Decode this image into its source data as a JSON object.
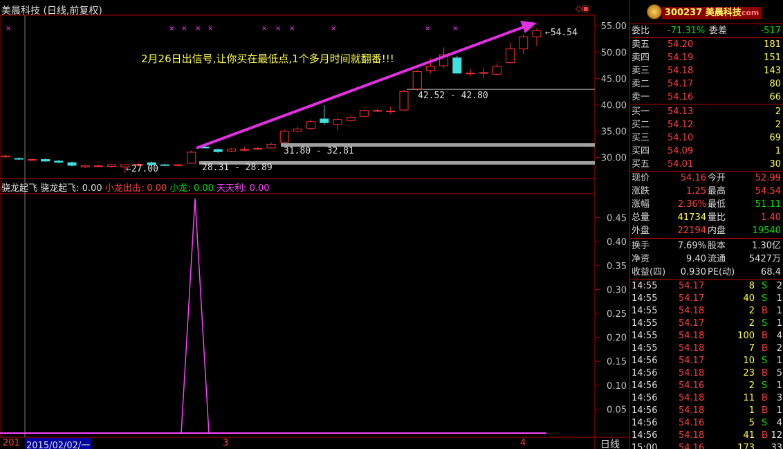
{
  "header": {
    "title": "美晨科技 (日线,前复权)",
    "code": "300237",
    "name": "美晨科技",
    "brand_suffix": "com"
  },
  "price_chart": {
    "annotation": "2月26日出信号,让你买在最低点,1个多月时间就翻番!!!",
    "last_price_label": "54.54",
    "low_label": "27.00",
    "range_labels": [
      "28.31 - 28.89",
      "31.80 - 32.81",
      "42.52 - 42.80"
    ],
    "y_ticks": [
      "55.00",
      "50.00",
      "45.00",
      "40.00",
      "35.00",
      "30.00"
    ]
  },
  "indicator": {
    "title": "骁龙起飞",
    "items": [
      {
        "label": "骁龙起飞:",
        "value": "0.00",
        "color": "#e0e0e0"
      },
      {
        "label": "小龙出击:",
        "value": "0.00",
        "color": "#ff4040"
      },
      {
        "label": "小龙:",
        "value": "0.00",
        "color": "#00e000"
      },
      {
        "label": "天天利:",
        "value": "0.00",
        "color": "#ff40ff"
      }
    ],
    "y_ticks": [
      "0.45",
      "0.40",
      "0.35",
      "0.30",
      "0.25",
      "0.20",
      "0.15",
      "0.10",
      "0.05"
    ]
  },
  "x_axis": {
    "year_prefix": "201",
    "cursor_date": "2015/02/02/一",
    "month_labels": [
      "3",
      "4"
    ],
    "period": "日线"
  },
  "order_book": {
    "ratio_label": "委比",
    "ratio_value": "-71.31%",
    "diff_label": "委差",
    "diff_value": "-517",
    "asks": [
      {
        "label": "卖五",
        "price": "54.20",
        "volume": "181"
      },
      {
        "label": "卖四",
        "price": "54.19",
        "volume": "151"
      },
      {
        "label": "卖三",
        "price": "54.18",
        "volume": "143"
      },
      {
        "label": "卖二",
        "price": "54.17",
        "volume": "80"
      },
      {
        "label": "卖一",
        "price": "54.16",
        "volume": "66"
      }
    ],
    "bids": [
      {
        "label": "买一",
        "price": "54.13",
        "volume": "2"
      },
      {
        "label": "买二",
        "price": "54.12",
        "volume": "2"
      },
      {
        "label": "买三",
        "price": "54.10",
        "volume": "69"
      },
      {
        "label": "买四",
        "price": "54.09",
        "volume": "1"
      },
      {
        "label": "买五",
        "price": "54.01",
        "volume": "30"
      }
    ]
  },
  "quote": {
    "rows": [
      {
        "l1": "现价",
        "v1": "54.16",
        "c1": "red",
        "l2": "今开",
        "v2": "52.99",
        "c2": "red"
      },
      {
        "l1": "涨跌",
        "v1": "1.25",
        "c1": "red",
        "l2": "最高",
        "v2": "54.54",
        "c2": "red"
      },
      {
        "l1": "涨幅",
        "v1": "2.36%",
        "c1": "red",
        "l2": "最低",
        "v2": "51.11",
        "c2": "green"
      },
      {
        "l1": "总量",
        "v1": "41734",
        "c1": "yellow",
        "l2": "量比",
        "v2": "1.40",
        "c2": "red"
      },
      {
        "l1": "外盘",
        "v1": "22194",
        "c1": "red",
        "l2": "内盘",
        "v2": "19540",
        "c2": "green"
      }
    ],
    "rows2": [
      {
        "l1": "换手",
        "v1": "7.69%",
        "l2": "股本",
        "v2": "1.30亿"
      },
      {
        "l1": "净资",
        "v1": "9.40",
        "l2": "流通",
        "v2": "5427万"
      },
      {
        "l1": "收益(四)",
        "v1": "0.930",
        "l2": "PE(动)",
        "v2": "68.4"
      }
    ]
  },
  "ticks": [
    {
      "time": "14:55",
      "price": "54.17",
      "vol": "8",
      "side": "S",
      "n": "2"
    },
    {
      "time": "14:55",
      "price": "54.17",
      "vol": "40",
      "side": "S",
      "n": "1"
    },
    {
      "time": "14:55",
      "price": "54.18",
      "vol": "2",
      "side": "B",
      "n": "1"
    },
    {
      "time": "14:55",
      "price": "54.17",
      "vol": "2",
      "side": "S",
      "n": "1"
    },
    {
      "time": "14:55",
      "price": "54.18",
      "vol": "100",
      "side": "B",
      "n": "4"
    },
    {
      "time": "14:55",
      "price": "54.18",
      "vol": "7",
      "side": "B",
      "n": "2"
    },
    {
      "time": "14:56",
      "price": "54.17",
      "vol": "10",
      "side": "S",
      "n": "1"
    },
    {
      "time": "14:56",
      "price": "54.18",
      "vol": "23",
      "side": "B",
      "n": "5"
    },
    {
      "time": "14:56",
      "price": "54.16",
      "vol": "2",
      "side": "S",
      "n": "1"
    },
    {
      "time": "14:56",
      "price": "54.18",
      "vol": "11",
      "side": "B",
      "n": "3"
    },
    {
      "time": "14:56",
      "price": "54.18",
      "vol": "1",
      "side": "B",
      "n": "1"
    },
    {
      "time": "14:56",
      "price": "54.16",
      "vol": "5",
      "side": "S",
      "n": "4"
    },
    {
      "time": "14:56",
      "price": "54.18",
      "vol": "41",
      "side": "B",
      "n": "12"
    },
    {
      "time": "15:00",
      "price": "54.16",
      "vol": "173",
      "side": "",
      "n": "33"
    }
  ],
  "colors": {
    "up": "#ff3030",
    "down": "#40e0e0",
    "grid": "#b00000",
    "arrow": "#e030e0",
    "annotation": "#ffff40",
    "support_band": "#a0a0a0"
  },
  "chart_data": {
    "type": "candlestick",
    "y_unit": "price",
    "ylim": [
      26,
      57
    ],
    "candles": [
      {
        "o": 30.1,
        "c": 30.3,
        "h": 30.5,
        "l": 29.9
      },
      {
        "o": 29.8,
        "c": 29.7,
        "h": 30.0,
        "l": 29.5
      },
      {
        "o": 29.6,
        "c": 29.6,
        "h": 29.8,
        "l": 29.4
      },
      {
        "o": 29.6,
        "c": 29.3,
        "h": 29.8,
        "l": 29.2
      },
      {
        "o": 29.3,
        "c": 29.1,
        "h": 29.5,
        "l": 28.9
      },
      {
        "o": 29.0,
        "c": 28.5,
        "h": 29.2,
        "l": 28.3
      },
      {
        "o": 28.2,
        "c": 28.4,
        "h": 28.6,
        "l": 28.0
      },
      {
        "o": 28.4,
        "c": 28.4,
        "h": 28.6,
        "l": 28.2
      },
      {
        "o": 28.3,
        "c": 28.6,
        "h": 28.7,
        "l": 28.1
      },
      {
        "o": 28.2,
        "c": 28.6,
        "h": 28.7,
        "l": 27.0
      },
      {
        "o": 28.5,
        "c": 28.7,
        "h": 28.9,
        "l": 28.3
      },
      {
        "o": 29.0,
        "c": 28.6,
        "h": 29.2,
        "l": 28.4
      },
      {
        "o": 28.6,
        "c": 28.5,
        "h": 28.8,
        "l": 28.4
      },
      {
        "o": 28.6,
        "c": 28.6,
        "h": 28.7,
        "l": 28.4
      },
      {
        "o": 28.9,
        "c": 31.0,
        "h": 31.3,
        "l": 28.8
      },
      {
        "o": 32.0,
        "c": 31.8,
        "h": 32.2,
        "l": 31.7
      },
      {
        "o": 31.5,
        "c": 31.1,
        "h": 31.7,
        "l": 30.9
      },
      {
        "o": 31.2,
        "c": 31.6,
        "h": 31.8,
        "l": 31.0
      },
      {
        "o": 31.5,
        "c": 31.5,
        "h": 31.9,
        "l": 31.2
      },
      {
        "o": 31.6,
        "c": 31.7,
        "h": 32.0,
        "l": 31.4
      },
      {
        "o": 31.8,
        "c": 32.5,
        "h": 32.8,
        "l": 31.7
      },
      {
        "o": 32.9,
        "c": 35.0,
        "h": 35.3,
        "l": 32.8
      },
      {
        "o": 35.0,
        "c": 35.4,
        "h": 35.8,
        "l": 34.8
      },
      {
        "o": 35.5,
        "c": 36.8,
        "h": 37.2,
        "l": 35.2
      },
      {
        "o": 37.3,
        "c": 36.6,
        "h": 39.9,
        "l": 36.2
      },
      {
        "o": 36.3,
        "c": 37.2,
        "h": 37.6,
        "l": 35.2
      },
      {
        "o": 37.0,
        "c": 37.6,
        "h": 38.0,
        "l": 36.8
      },
      {
        "o": 37.8,
        "c": 38.9,
        "h": 39.1,
        "l": 37.6
      },
      {
        "o": 38.9,
        "c": 38.9,
        "h": 39.3,
        "l": 38.6
      },
      {
        "o": 38.8,
        "c": 38.8,
        "h": 39.6,
        "l": 38.3
      },
      {
        "o": 39.0,
        "c": 42.5,
        "h": 42.8,
        "l": 38.8
      },
      {
        "o": 43.0,
        "c": 46.3,
        "h": 46.6,
        "l": 42.6
      },
      {
        "o": 46.5,
        "c": 47.3,
        "h": 48.8,
        "l": 46.0
      },
      {
        "o": 47.4,
        "c": 49.5,
        "h": 50.9,
        "l": 47.0
      },
      {
        "o": 48.9,
        "c": 46.0,
        "h": 49.3,
        "l": 45.9
      },
      {
        "o": 46.0,
        "c": 46.0,
        "h": 46.8,
        "l": 45.4
      },
      {
        "o": 46.1,
        "c": 46.1,
        "h": 47.0,
        "l": 45.0
      },
      {
        "o": 45.8,
        "c": 47.3,
        "h": 47.7,
        "l": 45.5
      },
      {
        "o": 48.0,
        "c": 50.6,
        "h": 51.8,
        "l": 47.8
      },
      {
        "o": 50.6,
        "c": 52.9,
        "h": 53.4,
        "l": 49.6
      },
      {
        "o": 52.9,
        "c": 54.1,
        "h": 54.5,
        "l": 51.1
      }
    ],
    "signal_series": {
      "name": "天天利",
      "ylim": [
        0,
        0.5
      ],
      "values_by_index": {
        "13": 0.0,
        "14": 0.49,
        "15": 0.0
      }
    }
  }
}
